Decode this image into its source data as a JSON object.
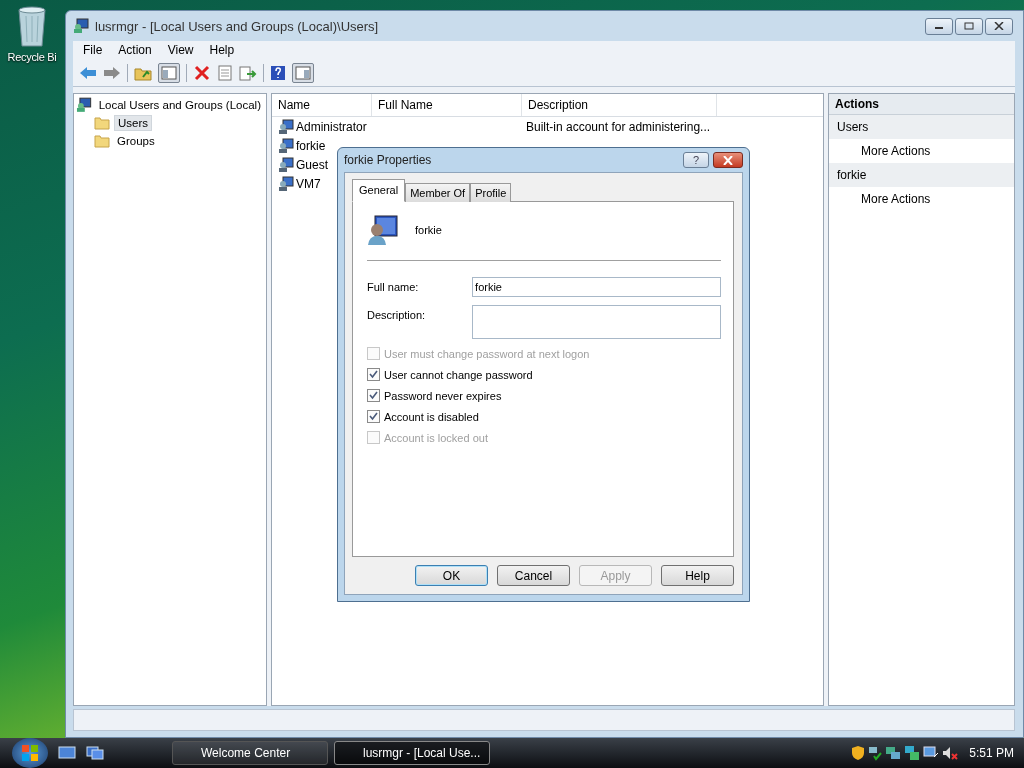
{
  "desktop": {
    "icons": [
      {
        "label": "Recycle Bi"
      }
    ]
  },
  "window": {
    "title": "lusrmgr - [Local Users and Groups (Local)\\Users]",
    "menu": [
      "File",
      "Action",
      "View",
      "Help"
    ],
    "tree": {
      "label": "Local Users and Groups (Local)",
      "children": [
        {
          "label": "Users",
          "selected": true
        },
        {
          "label": "Groups",
          "selected": false
        }
      ]
    },
    "list": {
      "columns": [
        "Name",
        "Full Name",
        "Description"
      ],
      "rows": [
        {
          "name": "Administrator",
          "description": "Built-in account for administering..."
        },
        {
          "name": "forkie"
        },
        {
          "name": "Guest"
        },
        {
          "name": "VM7"
        }
      ]
    },
    "actions": {
      "title": "Actions",
      "sections": [
        {
          "label": "Users",
          "items": [
            "More Actions"
          ]
        },
        {
          "label": "forkie",
          "items": [
            "More Actions"
          ]
        }
      ]
    }
  },
  "dialog": {
    "title": "forkie Properties",
    "help": "?",
    "tabs": [
      {
        "label": "General",
        "selected": true
      },
      {
        "label": "Member Of",
        "selected": false
      },
      {
        "label": "Profile",
        "selected": false
      }
    ],
    "user": "forkie",
    "fields": [
      {
        "label": "Full name:",
        "value": "forkie",
        "kind": "single"
      },
      {
        "label": "Description:",
        "kind": "multi"
      }
    ],
    "checkboxes": [
      {
        "label": "User must change password at next logon",
        "checked": false,
        "disabled": true
      },
      {
        "label": "User cannot change password",
        "checked": true,
        "disabled": false
      },
      {
        "label": "Password never expires",
        "checked": true,
        "disabled": false
      },
      {
        "label": "Account is disabled",
        "checked": true,
        "disabled": false
      },
      {
        "label": "Account is locked out",
        "checked": false,
        "disabled": true
      }
    ],
    "buttons": [
      {
        "label": "OK",
        "default": true,
        "disabled": false
      },
      {
        "label": "Cancel",
        "default": false,
        "disabled": false
      },
      {
        "label": "Apply",
        "default": false,
        "disabled": true
      },
      {
        "label": "Help",
        "default": false,
        "disabled": false
      }
    ]
  },
  "taskbar": {
    "tasks": [
      {
        "label": "Welcome Center",
        "selected": false
      },
      {
        "label": "lusrmgr - [Local Use...",
        "selected": true
      }
    ],
    "clock": "5:51 PM"
  }
}
